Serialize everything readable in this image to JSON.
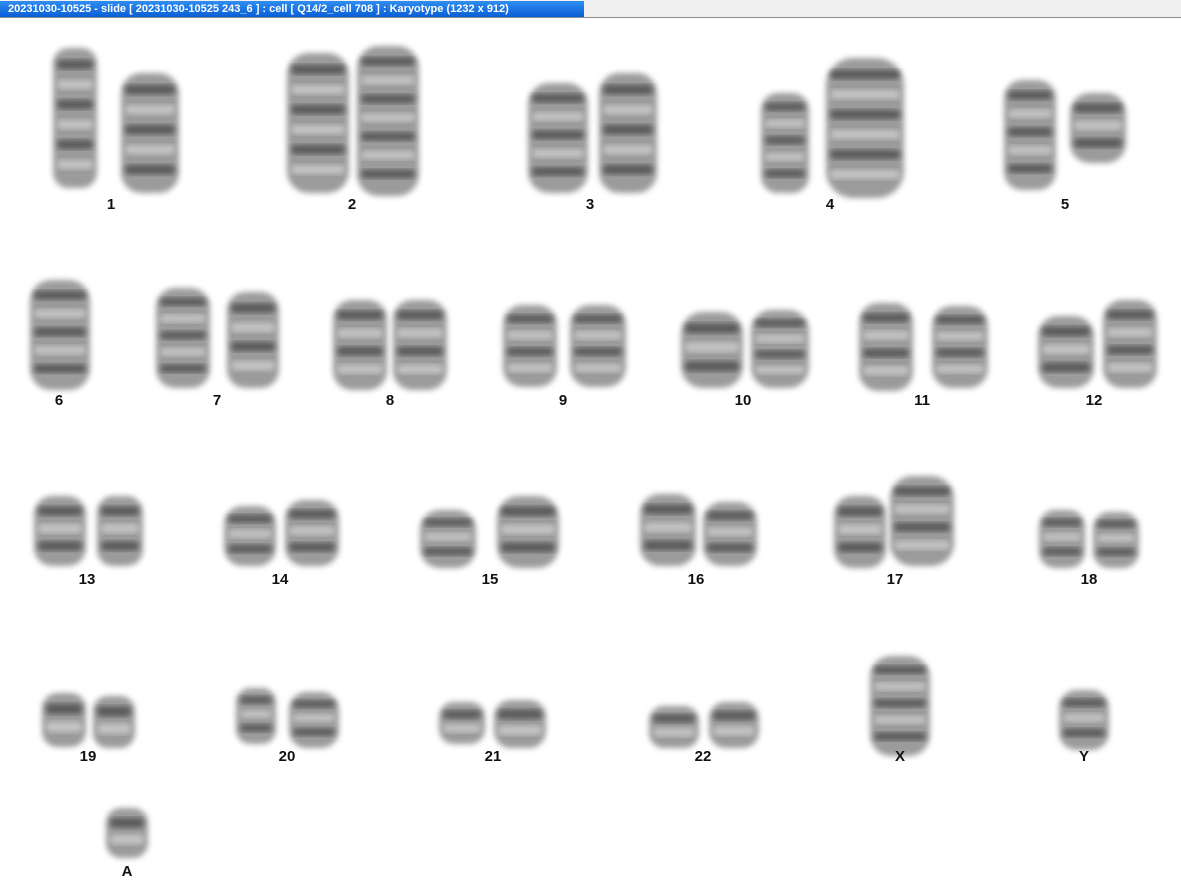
{
  "window": {
    "title": "20231030-10525 - slide [ 20231030-10525 243_6 ] : cell [ Q14/2_cell 708 ] : Karyotype  (1232 x 912)"
  },
  "karyotype": {
    "labels": [
      "1",
      "2",
      "3",
      "4",
      "5",
      "6",
      "7",
      "8",
      "9",
      "10",
      "11",
      "12",
      "13",
      "14",
      "15",
      "16",
      "17",
      "18",
      "19",
      "20",
      "21",
      "22",
      "X",
      "Y",
      "A"
    ]
  }
}
